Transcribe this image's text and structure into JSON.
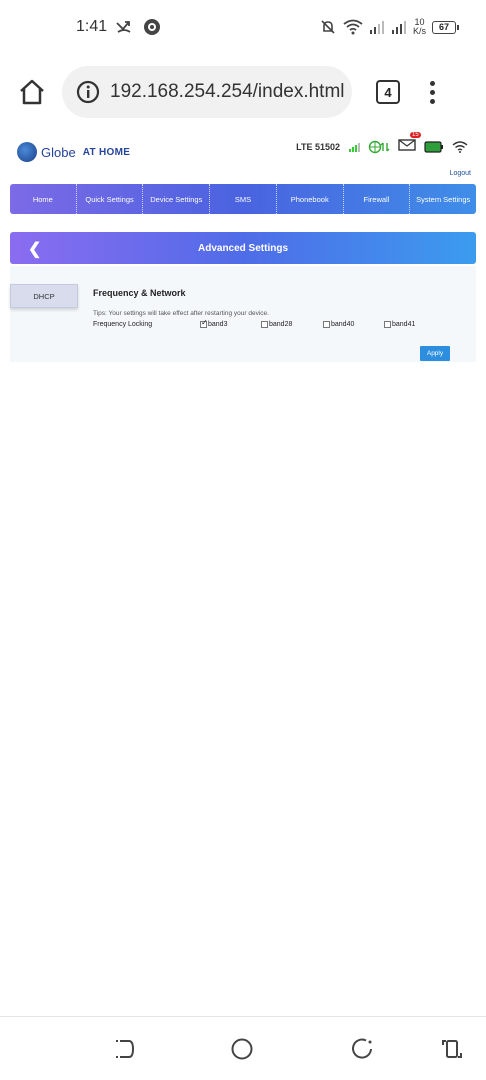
{
  "status": {
    "time": "1:41",
    "net_speed_value": "10",
    "net_speed_unit": "K/s",
    "battery": "67"
  },
  "browser": {
    "url": "192.168.254.254/index.html",
    "tab_count": "4"
  },
  "router": {
    "brand": "Globe",
    "brand_suffix": "AT HOME",
    "network": "LTE  51502",
    "mail_count": "15",
    "logout": "Logout",
    "nav": [
      "Home",
      "Quick Settings",
      "Device Settings",
      "SMS",
      "Phonebook",
      "Firewall",
      "System Settings"
    ],
    "page_title": "Advanced Settings",
    "side_tab": "DHCP",
    "section_title": "Frequency & Network",
    "tips": "Tips: Your settings will take effect after restarting your device.",
    "freq_label": "Frequency Locking",
    "bands": [
      {
        "label": "band3",
        "checked": true
      },
      {
        "label": "band28",
        "checked": false
      },
      {
        "label": "band40",
        "checked": false
      },
      {
        "label": "band41",
        "checked": false
      }
    ],
    "apply": "Apply"
  },
  "colors": {
    "nav_start": "#7c6ae6",
    "nav_end": "#3f8ee8",
    "apply": "#2d8ee0"
  }
}
